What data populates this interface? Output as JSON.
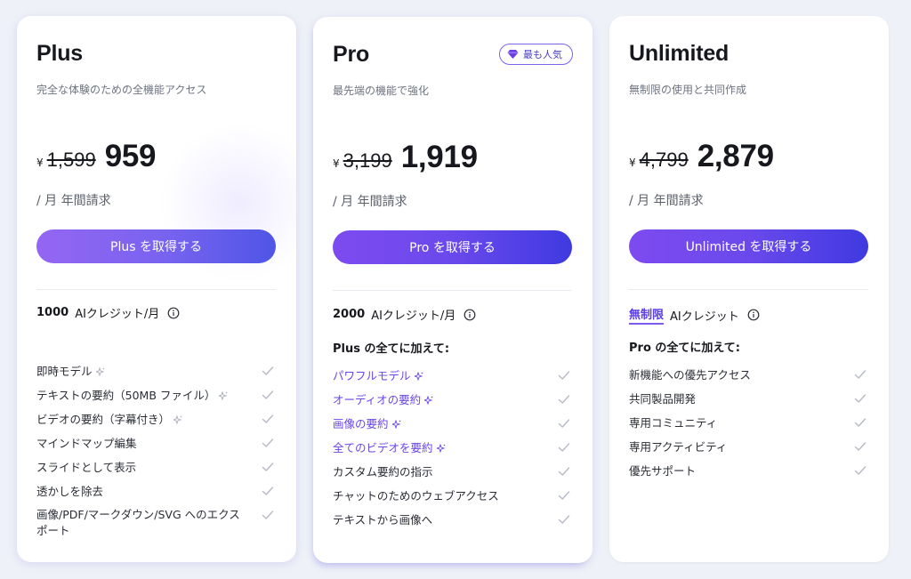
{
  "colors": {
    "accent": "#6a45e8",
    "button_start": "#7d4bf0",
    "button_end": "#3f3ae0",
    "background": "#eef1f7",
    "check": "#b8bcc6"
  },
  "plans": [
    {
      "name": "Plus",
      "description": "完全な体験のための全機能アクセス",
      "currency": "¥",
      "old_price": "1,599",
      "price": "959",
      "period": "/ 月 年間請求",
      "cta": "Plus を取得する",
      "credits_amount": "1000",
      "credits_label": "AIクレジット/月",
      "features": [
        {
          "label": "即時モデル",
          "icon": "sparkle-icon"
        },
        {
          "label": "テキストの要約（50MB ファイル）",
          "icon": "sparkle-icon"
        },
        {
          "label": "ビデオの要約（字幕付き）",
          "icon": "sparkle-icon"
        },
        {
          "label": "マインドマップ編集"
        },
        {
          "label": "スライドとして表示"
        },
        {
          "label": "透かしを除去"
        },
        {
          "label": "画像/PDF/マークダウン/SVG へのエクスポート"
        }
      ]
    },
    {
      "name": "Pro",
      "badge": "最も人気",
      "description": "最先端の機能で強化",
      "currency": "¥",
      "old_price": "3,199",
      "price": "1,919",
      "period": "/ 月 年間請求",
      "cta": "Pro を取得する",
      "credits_amount": "2000",
      "credits_label": "AIクレジット/月",
      "section_head": "Plus の全てに加えて:",
      "features": [
        {
          "label": "パワフルモデル",
          "icon": "sparkle-icon",
          "accent": true
        },
        {
          "label": "オーディオの要約",
          "icon": "sparkle-icon",
          "accent": true
        },
        {
          "label": "画像の要約",
          "icon": "sparkle-icon",
          "accent": true
        },
        {
          "label": "全てのビデオを要約",
          "icon": "sparkle-icon",
          "accent": true
        },
        {
          "label": "カスタム要約の指示"
        },
        {
          "label": "チャットのためのウェブアクセス"
        },
        {
          "label": "テキストから画像へ"
        }
      ]
    },
    {
      "name": "Unlimited",
      "description": "無制限の使用と共同作成",
      "currency": "¥",
      "old_price": "4,799",
      "price": "2,879",
      "period": "/ 月 年間請求",
      "cta": "Unlimited を取得する",
      "credits_amount": "無制限",
      "credits_label": "AIクレジット",
      "section_head": "Pro の全てに加えて:",
      "features": [
        {
          "label": "新機能への優先アクセス"
        },
        {
          "label": "共同製品開発"
        },
        {
          "label": "専用コミュニティ"
        },
        {
          "label": "専用アクティビティ"
        },
        {
          "label": "優先サポート"
        }
      ]
    }
  ]
}
